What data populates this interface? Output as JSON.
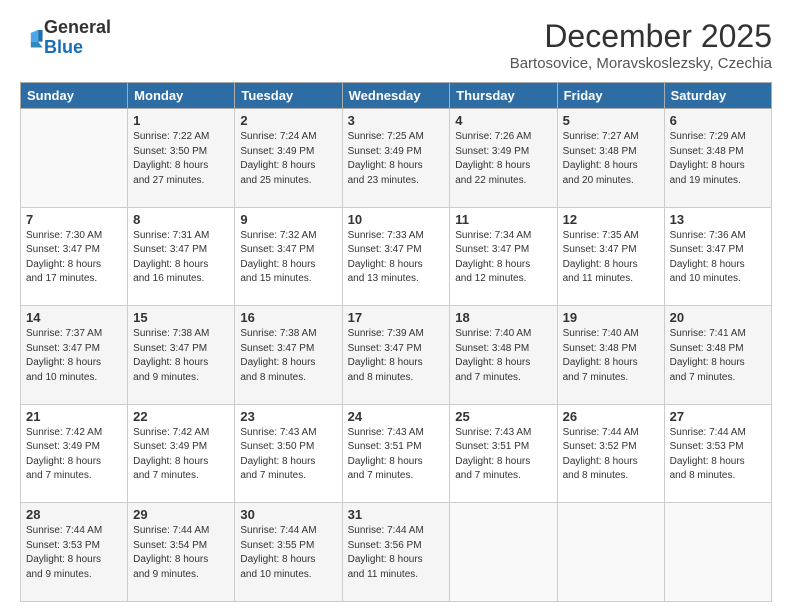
{
  "logo": {
    "general": "General",
    "blue": "Blue"
  },
  "header": {
    "title": "December 2025",
    "subtitle": "Bartosovice, Moravskoslezsky, Czechia"
  },
  "calendar": {
    "days_of_week": [
      "Sunday",
      "Monday",
      "Tuesday",
      "Wednesday",
      "Thursday",
      "Friday",
      "Saturday"
    ],
    "weeks": [
      [
        {
          "num": "",
          "info": ""
        },
        {
          "num": "1",
          "info": "Sunrise: 7:22 AM\nSunset: 3:50 PM\nDaylight: 8 hours\nand 27 minutes."
        },
        {
          "num": "2",
          "info": "Sunrise: 7:24 AM\nSunset: 3:49 PM\nDaylight: 8 hours\nand 25 minutes."
        },
        {
          "num": "3",
          "info": "Sunrise: 7:25 AM\nSunset: 3:49 PM\nDaylight: 8 hours\nand 23 minutes."
        },
        {
          "num": "4",
          "info": "Sunrise: 7:26 AM\nSunset: 3:49 PM\nDaylight: 8 hours\nand 22 minutes."
        },
        {
          "num": "5",
          "info": "Sunrise: 7:27 AM\nSunset: 3:48 PM\nDaylight: 8 hours\nand 20 minutes."
        },
        {
          "num": "6",
          "info": "Sunrise: 7:29 AM\nSunset: 3:48 PM\nDaylight: 8 hours\nand 19 minutes."
        }
      ],
      [
        {
          "num": "7",
          "info": "Sunrise: 7:30 AM\nSunset: 3:47 PM\nDaylight: 8 hours\nand 17 minutes."
        },
        {
          "num": "8",
          "info": "Sunrise: 7:31 AM\nSunset: 3:47 PM\nDaylight: 8 hours\nand 16 minutes."
        },
        {
          "num": "9",
          "info": "Sunrise: 7:32 AM\nSunset: 3:47 PM\nDaylight: 8 hours\nand 15 minutes."
        },
        {
          "num": "10",
          "info": "Sunrise: 7:33 AM\nSunset: 3:47 PM\nDaylight: 8 hours\nand 13 minutes."
        },
        {
          "num": "11",
          "info": "Sunrise: 7:34 AM\nSunset: 3:47 PM\nDaylight: 8 hours\nand 12 minutes."
        },
        {
          "num": "12",
          "info": "Sunrise: 7:35 AM\nSunset: 3:47 PM\nDaylight: 8 hours\nand 11 minutes."
        },
        {
          "num": "13",
          "info": "Sunrise: 7:36 AM\nSunset: 3:47 PM\nDaylight: 8 hours\nand 10 minutes."
        }
      ],
      [
        {
          "num": "14",
          "info": "Sunrise: 7:37 AM\nSunset: 3:47 PM\nDaylight: 8 hours\nand 10 minutes."
        },
        {
          "num": "15",
          "info": "Sunrise: 7:38 AM\nSunset: 3:47 PM\nDaylight: 8 hours\nand 9 minutes."
        },
        {
          "num": "16",
          "info": "Sunrise: 7:38 AM\nSunset: 3:47 PM\nDaylight: 8 hours\nand 8 minutes."
        },
        {
          "num": "17",
          "info": "Sunrise: 7:39 AM\nSunset: 3:47 PM\nDaylight: 8 hours\nand 8 minutes."
        },
        {
          "num": "18",
          "info": "Sunrise: 7:40 AM\nSunset: 3:48 PM\nDaylight: 8 hours\nand 7 minutes."
        },
        {
          "num": "19",
          "info": "Sunrise: 7:40 AM\nSunset: 3:48 PM\nDaylight: 8 hours\nand 7 minutes."
        },
        {
          "num": "20",
          "info": "Sunrise: 7:41 AM\nSunset: 3:48 PM\nDaylight: 8 hours\nand 7 minutes."
        }
      ],
      [
        {
          "num": "21",
          "info": "Sunrise: 7:42 AM\nSunset: 3:49 PM\nDaylight: 8 hours\nand 7 minutes."
        },
        {
          "num": "22",
          "info": "Sunrise: 7:42 AM\nSunset: 3:49 PM\nDaylight: 8 hours\nand 7 minutes."
        },
        {
          "num": "23",
          "info": "Sunrise: 7:43 AM\nSunset: 3:50 PM\nDaylight: 8 hours\nand 7 minutes."
        },
        {
          "num": "24",
          "info": "Sunrise: 7:43 AM\nSunset: 3:51 PM\nDaylight: 8 hours\nand 7 minutes."
        },
        {
          "num": "25",
          "info": "Sunrise: 7:43 AM\nSunset: 3:51 PM\nDaylight: 8 hours\nand 7 minutes."
        },
        {
          "num": "26",
          "info": "Sunrise: 7:44 AM\nSunset: 3:52 PM\nDaylight: 8 hours\nand 8 minutes."
        },
        {
          "num": "27",
          "info": "Sunrise: 7:44 AM\nSunset: 3:53 PM\nDaylight: 8 hours\nand 8 minutes."
        }
      ],
      [
        {
          "num": "28",
          "info": "Sunrise: 7:44 AM\nSunset: 3:53 PM\nDaylight: 8 hours\nand 9 minutes."
        },
        {
          "num": "29",
          "info": "Sunrise: 7:44 AM\nSunset: 3:54 PM\nDaylight: 8 hours\nand 9 minutes."
        },
        {
          "num": "30",
          "info": "Sunrise: 7:44 AM\nSunset: 3:55 PM\nDaylight: 8 hours\nand 10 minutes."
        },
        {
          "num": "31",
          "info": "Sunrise: 7:44 AM\nSunset: 3:56 PM\nDaylight: 8 hours\nand 11 minutes."
        },
        {
          "num": "",
          "info": ""
        },
        {
          "num": "",
          "info": ""
        },
        {
          "num": "",
          "info": ""
        }
      ]
    ]
  }
}
